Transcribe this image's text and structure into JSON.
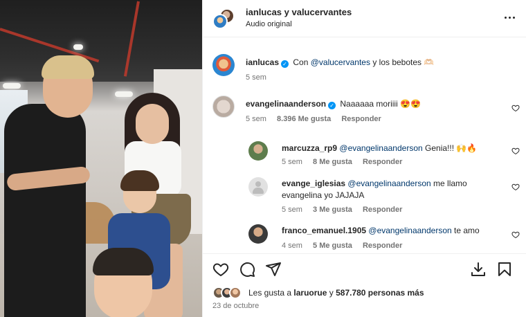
{
  "post": {
    "header": {
      "title": "ianlucas y valucervantes",
      "subtitle": "Audio original"
    },
    "caption": {
      "username": "ianlucas",
      "verified": true,
      "text_prefix": "Con",
      "mention": "@valucervantes",
      "text_suffix": "y los bebotes 🫶🏻",
      "time": "5 sem"
    },
    "comments": [
      {
        "username": "evangelinaanderson",
        "verified": true,
        "text": "Naaaaaa moriiii 😍😍",
        "time": "5 sem",
        "likes": "8.396 Me gusta",
        "reply_label": "Responder"
      }
    ],
    "replies": [
      {
        "username": "marcuzza_rp9",
        "mention": "@evangelinaanderson",
        "text": "Genia!!! 🙌🔥",
        "time": "5 sem",
        "likes": "8 Me gusta",
        "reply_label": "Responder"
      },
      {
        "username": "evange_iglesias",
        "mention": "@evangelinaanderson",
        "text_line1": "me llamo",
        "text_line2": "evangelina yo JAJAJA",
        "time": "5 sem",
        "likes": "3 Me gusta",
        "reply_label": "Responder"
      },
      {
        "username": "franco_emanuel.1905",
        "mention": "@evangelinaanderson",
        "text": "te amo",
        "time": "4 sem",
        "likes": "5 Me gusta",
        "reply_label": "Responder"
      }
    ],
    "likes_summary": {
      "prefix": "Les gusta a",
      "user": "laruorue",
      "suffix_y": "y",
      "count": "587.780 personas más"
    },
    "date": "23 de octubre"
  },
  "icons": {
    "more": "more-horizontal-icon",
    "like": "heart-icon",
    "comment": "comment-icon",
    "share": "send-icon",
    "download": "download-icon",
    "save": "bookmark-icon",
    "verified": "verified-badge-icon"
  },
  "colors": {
    "text": "#262626",
    "muted": "#737373",
    "link": "#00376b",
    "verified": "#0095f6",
    "divider": "#efefef"
  }
}
